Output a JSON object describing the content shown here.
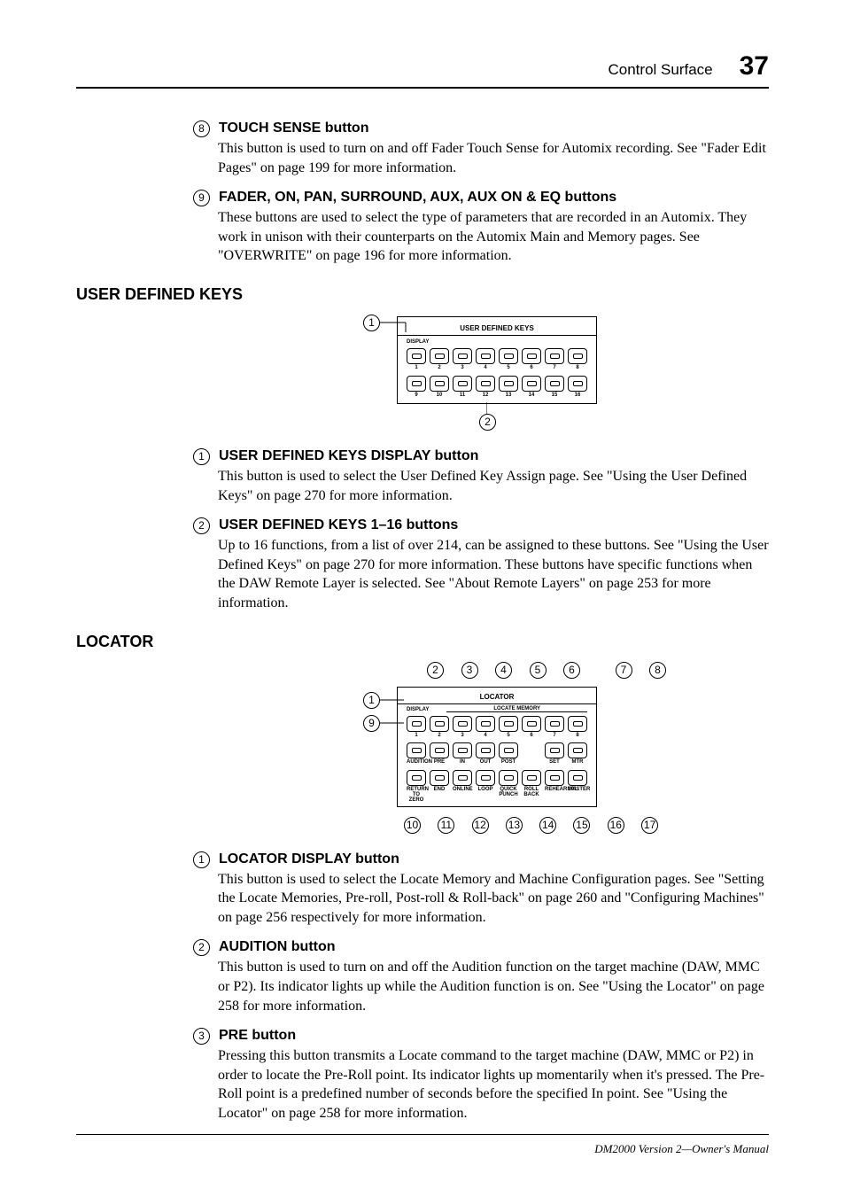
{
  "header": {
    "section": "Control Surface",
    "page": "37"
  },
  "items_top": [
    {
      "num": "8",
      "title": "TOUCH SENSE button",
      "body": "This button is used to turn on and off Fader Touch Sense for Automix recording. See \"Fader Edit Pages\" on page 199 for more information."
    },
    {
      "num": "9",
      "title": "FADER, ON, PAN, SURROUND, AUX, AUX ON & EQ buttons",
      "body": "These buttons are used to select the type of parameters that are recorded in an Automix. They work in unison with their counterparts on the Automix Main and Memory pages. See \"OVERWRITE\" on page 196 for more information."
    }
  ],
  "sections": {
    "udk": {
      "title": "USER DEFINED KEYS",
      "diagram": {
        "panel_label": "USER DEFINED KEYS",
        "display_label": "DISPLAY",
        "row1": [
          "1",
          "2",
          "3",
          "4",
          "5",
          "6",
          "7",
          "8"
        ],
        "row2": [
          "9",
          "10",
          "11",
          "12",
          "13",
          "14",
          "15",
          "16"
        ],
        "callouts": {
          "1": "1",
          "2": "2"
        }
      },
      "items": [
        {
          "num": "1",
          "title": "USER DEFINED KEYS DISPLAY button",
          "body": "This button is used to select the User Defined Key Assign page. See \"Using the User Defined Keys\" on page 270 for more information."
        },
        {
          "num": "2",
          "title": "USER DEFINED KEYS 1–16 buttons",
          "body": "Up to 16 functions, from a list of over 214, can be assigned to these buttons. See \"Using the User Defined Keys\" on page 270 for more information. These buttons have specific functions when the DAW Remote Layer is selected. See \"About Remote Layers\" on page 253 for more information."
        }
      ]
    },
    "locator": {
      "title": "LOCATOR",
      "diagram": {
        "panel_label": "LOCATOR",
        "display_label": "DISPLAY",
        "locate_memory_label": "LOCATE MEMORY",
        "row1": [
          "1",
          "2",
          "3",
          "4",
          "5",
          "6",
          "7",
          "8"
        ],
        "row2": [
          "AUDITION",
          "PRE",
          "IN",
          "OUT",
          "POST",
          "",
          "SET",
          "MTR"
        ],
        "row3": [
          "RETURN TO ZERO",
          "END",
          "ONLINE",
          "LOOP",
          "QUICK PUNCH",
          "ROLL BACK",
          "REHEARSAL",
          "MASTER"
        ],
        "callouts_top": [
          "2",
          "3",
          "4",
          "5",
          "6",
          "7",
          "8"
        ],
        "callouts_left": [
          "1",
          "9"
        ],
        "callouts_bottom": [
          "10",
          "11",
          "12",
          "13",
          "14",
          "15",
          "16",
          "17"
        ]
      },
      "items": [
        {
          "num": "1",
          "title": "LOCATOR DISPLAY button",
          "body": "This button is used to select the Locate Memory and Machine Configuration pages. See \"Setting the Locate Memories, Pre-roll, Post-roll & Roll-back\" on page 260 and \"Configuring Machines\" on page 256 respectively for more information."
        },
        {
          "num": "2",
          "title": "AUDITION button",
          "body": "This button is used to turn on and off the Audition function on the target machine (DAW, MMC or P2). Its indicator lights up while the Audition function is on. See \"Using the Locator\" on page 258 for more information."
        },
        {
          "num": "3",
          "title": "PRE button",
          "body": "Pressing this button transmits a Locate command to the target machine (DAW, MMC or P2) in order to locate the Pre-Roll point. Its indicator lights up momentarily when it's pressed. The Pre-Roll point is a predefined number of seconds before the specified In point. See \"Using the Locator\" on page 258 for more information."
        }
      ]
    }
  },
  "footer": "DM2000 Version 2—Owner's Manual"
}
